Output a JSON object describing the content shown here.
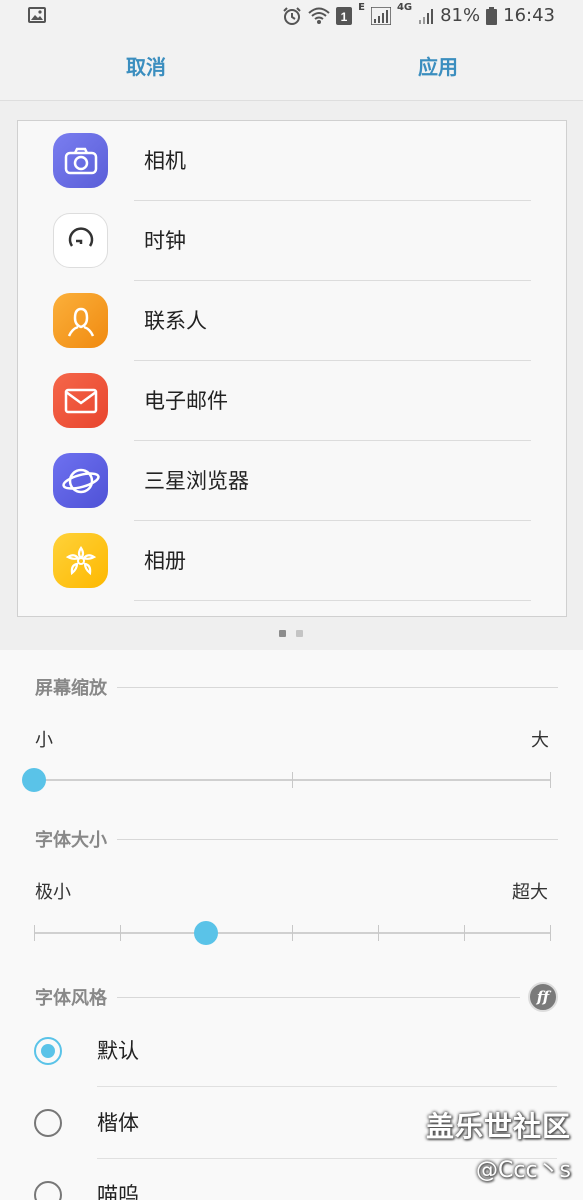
{
  "status_bar": {
    "battery": "81%",
    "time": "16:43",
    "network_e": "E",
    "network_4g": "4G",
    "notification_count": "1",
    "icons": [
      "image-icon",
      "alarm-icon",
      "wifi-icon",
      "notification-count-icon",
      "signal-icon",
      "battery-icon"
    ]
  },
  "action_bar": {
    "cancel_label": "取消",
    "apply_label": "应用"
  },
  "preview": {
    "apps": [
      {
        "name": "相机",
        "icon": "camera-icon",
        "color": "#6b6fe0"
      },
      {
        "name": "时钟",
        "icon": "clock-icon",
        "color": "#ffffff"
      },
      {
        "name": "联系人",
        "icon": "contacts-icon",
        "color": "#f7a21e"
      },
      {
        "name": "电子邮件",
        "icon": "email-icon",
        "color": "#f05a3c"
      },
      {
        "name": "三星浏览器",
        "icon": "browser-icon",
        "color": "#5b5fe0"
      },
      {
        "name": "相册",
        "icon": "gallery-icon",
        "color": "#ffc61a"
      }
    ],
    "page_indicator": {
      "current": 1,
      "total": 2
    }
  },
  "screen_zoom": {
    "title": "屏幕缩放",
    "min_label": "小",
    "max_label": "大",
    "level": 0,
    "steps": 3
  },
  "font_size": {
    "title": "字体大小",
    "min_label": "极小",
    "max_label": "超大",
    "level": 2,
    "steps": 7
  },
  "font_style": {
    "title": "字体风格",
    "icon": "font-download-icon",
    "ff_glyph": "ff",
    "options": [
      {
        "label": "默认",
        "checked": true
      },
      {
        "label": "楷体",
        "checked": false
      },
      {
        "label": "喵呜",
        "checked": false
      }
    ]
  },
  "watermark": {
    "line1": "盖乐世社区",
    "line2": "@Ccc丶s"
  },
  "accent_color": "#5ac3e8",
  "action_color": "#3b8ebf"
}
